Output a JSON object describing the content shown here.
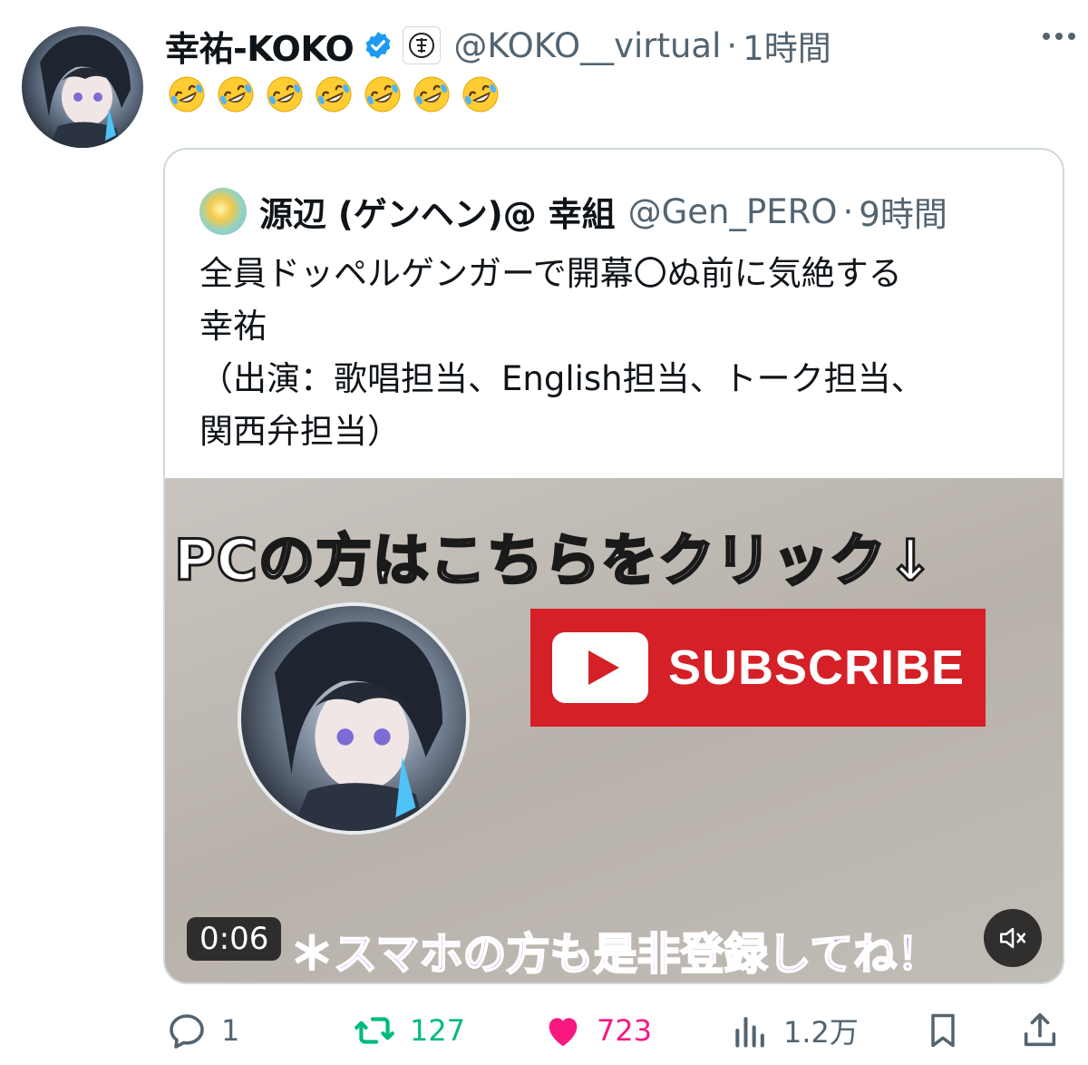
{
  "tweet": {
    "display_name": "幸祐-KOKO",
    "affiliation_badge": "神椿",
    "handle": "@KOKO__virtual",
    "separator": "·",
    "time": "1時間",
    "emoji": [
      "🤣",
      "🤣",
      "🤣",
      "🤣",
      "🤣",
      "🤣",
      "🤣"
    ]
  },
  "quote": {
    "display_name": "源辺 (ゲンヘン)@ 幸組",
    "handle": "@Gen_PERO",
    "separator": "·",
    "time": "9時間",
    "text_lines": [
      "全員ドッペルゲンガーで開幕〇ぬ前に気絶する",
      "幸祐",
      "（出演：歌唱担当、English担当、トーク担当、",
      "関西弁担当）"
    ],
    "media": {
      "pc_text": "PCの方はこちらをクリック↓",
      "subscribe_label": "SUBSCRIBE",
      "smartphone_text": "＊スマホの方も是非登録してね！",
      "duration": "0:06",
      "mute_icon": "speaker-muted-icon"
    }
  },
  "actions": {
    "reply_count": "1",
    "retweet_count": "127",
    "like_count": "723",
    "views_count": "1.2万"
  },
  "colors": {
    "verified": "#1d9bf0",
    "retweet": "#00ba7c",
    "like": "#f91880",
    "secondary_text": "#536471",
    "subscribe_red": "#d52027"
  }
}
